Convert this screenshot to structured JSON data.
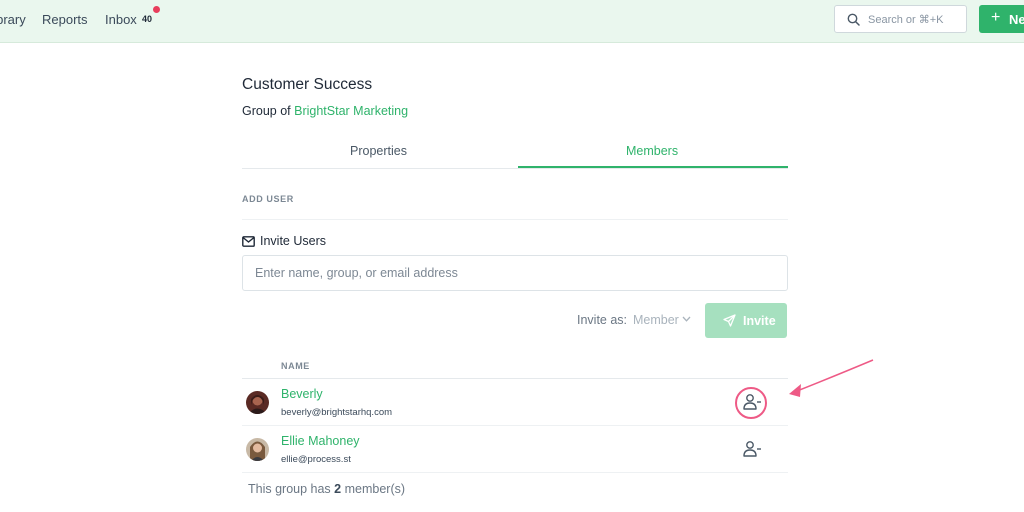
{
  "topbar": {
    "nav": [
      "Library",
      "Reports",
      "Inbox"
    ],
    "inbox_count": "40",
    "search_placeholder": "Search or ⌘+K",
    "new_button": "New"
  },
  "group": {
    "title": "Customer Success",
    "group_of_prefix": "Group of",
    "parent_name": "BrightStar Marketing"
  },
  "tabs": [
    {
      "label": "Properties",
      "active": false
    },
    {
      "label": "Members",
      "active": true
    }
  ],
  "add_user": {
    "section_label": "ADD USER",
    "invite_heading": "Invite Users",
    "input_placeholder": "Enter name, group, or email address",
    "invite_as_label": "Invite as:",
    "role_value": "Member",
    "invite_button": "Invite"
  },
  "members": {
    "column_header": "NAME",
    "rows": [
      {
        "name": "Beverly",
        "email": "beverly@brightstarhq.com"
      },
      {
        "name": "Ellie Mahoney",
        "email": "ellie@process.st"
      }
    ],
    "footer_prefix": "This group has",
    "count": "2",
    "footer_suffix": "member(s)"
  },
  "colors": {
    "accent": "#2fb36b",
    "accent_disabled": "#a6e0bf",
    "topbar_bg": "#eaf7ee",
    "annotation": "#ee5a86"
  },
  "icons": [
    "search-icon",
    "plus-icon",
    "mail-icon",
    "chevron-down-icon",
    "send-icon",
    "remove-user-icon"
  ]
}
